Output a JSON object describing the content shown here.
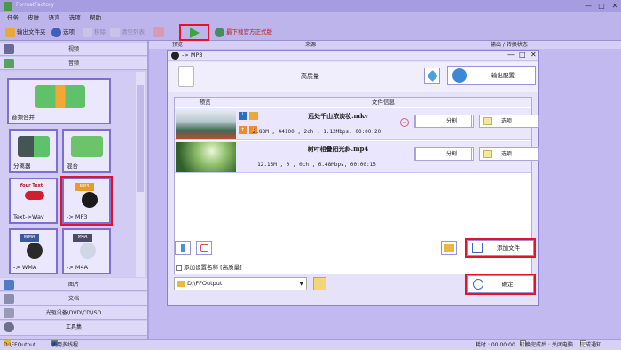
{
  "app": {
    "title": "FormatFactory"
  },
  "menu": [
    "任务",
    "皮肤",
    "语言",
    "选项",
    "帮助"
  ],
  "toolbar": {
    "output_folder": "输出文件夹",
    "options": "选项",
    "remove": "移除",
    "clear": "清空列表",
    "download_hint": "最下载官方正式版"
  },
  "window_controls": {
    "minimize": "—",
    "maximize": "□",
    "close": "✕"
  },
  "sidebar": {
    "video": "视频",
    "audio": "音频",
    "picture": "图片",
    "document": "文档",
    "disc": "光驱设备\\DVD\\CD\\ISO",
    "tools": "工具集",
    "tiles": [
      "音频合并",
      "分离器",
      "混合",
      "Text->Wav",
      "-> MP3",
      "-> WMA",
      "-> M4A"
    ],
    "tile_badges": {
      "mp3": "MP3",
      "wma": "WMA",
      "m4a": "M4A",
      "text": "Your Text"
    }
  },
  "column_header": {
    "preview": "预览",
    "source": "来源",
    "output": "输出 / 转换状态"
  },
  "dialog": {
    "title": "-> MP3",
    "quality": "高质量",
    "output_config": "输出配置",
    "table": {
      "preview": "预览",
      "file_info": "文件信息"
    },
    "files": [
      {
        "name": "远处千山浓淡妆.mkv",
        "info": "2.83M , 44100 , 2ch , 1.12Mbps, 00:00:20"
      },
      {
        "name": "树叶相叠阳光斜.mp4",
        "info": "12.15M , 0 , 0ch , 6.48Mbps, 00:00:15"
      }
    ],
    "split_label": "分割",
    "options_label": "选项",
    "add_file": "添加文件",
    "add_setting_name": "添加设置名称 [高质量]",
    "output_path": "D:\\FFOutput",
    "ok": "确定"
  },
  "statusbar": {
    "path": "D:\\FFOutput",
    "multithread": "使用多线程",
    "elapsed": "耗时 : 00:00:00",
    "after_convert": "转换完成后 : 关闭电脑",
    "notify": "完成通知"
  },
  "colors": {
    "accent_red": "#e0142a",
    "play_green": "#3aa53a",
    "panel": "#c1b9f0"
  }
}
